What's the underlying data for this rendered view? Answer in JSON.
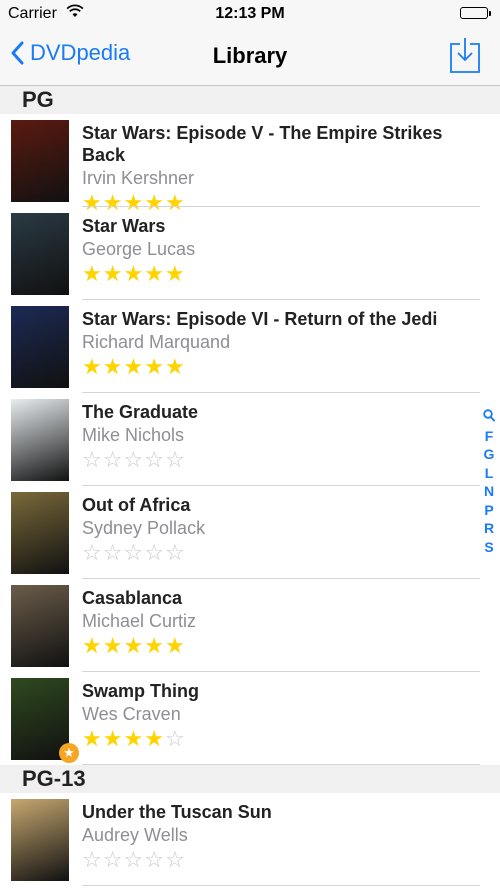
{
  "status_bar": {
    "carrier": "Carrier",
    "time": "12:13 PM"
  },
  "navbar": {
    "back_label": "DVDpedia",
    "title": "Library"
  },
  "index": [
    "F",
    "G",
    "L",
    "N",
    "P",
    "R",
    "S"
  ],
  "sections": [
    {
      "label": "PG"
    },
    {
      "label": "PG-13"
    }
  ],
  "movies": [
    {
      "title": "Star Wars: Episode V - The Empire Strikes Back",
      "director": "Irvin Kershner",
      "rating": 5,
      "cover_color": "#5b1a10"
    },
    {
      "title": "Star Wars",
      "director": "George Lucas",
      "rating": 5,
      "cover_color": "#2a3a44"
    },
    {
      "title": "Star Wars: Episode VI - Return of the Jedi",
      "director": "Richard Marquand",
      "rating": 5,
      "cover_color": "#1c2a55"
    },
    {
      "title": "The Graduate",
      "director": "Mike Nichols",
      "rating": 0,
      "cover_color": "#e8edf0"
    },
    {
      "title": "Out of Africa",
      "director": "Sydney Pollack",
      "rating": 0,
      "cover_color": "#7a6a3a"
    },
    {
      "title": "Casablanca",
      "director": "Michael Curtiz",
      "rating": 5,
      "cover_color": "#6b5d4a"
    },
    {
      "title": "Swamp Thing",
      "director": "Wes Craven",
      "rating": 4,
      "cover_color": "#2f4a1f",
      "favorite": true
    },
    {
      "title": "Under the Tuscan Sun",
      "director": "Audrey Wells",
      "rating": 0,
      "cover_color": "#c7a870"
    }
  ],
  "colors": {
    "accent": "#1a7cf5",
    "star_on": "#ffd400",
    "star_off": "#c9c9c9",
    "favorite_badge": "#f5a623"
  }
}
